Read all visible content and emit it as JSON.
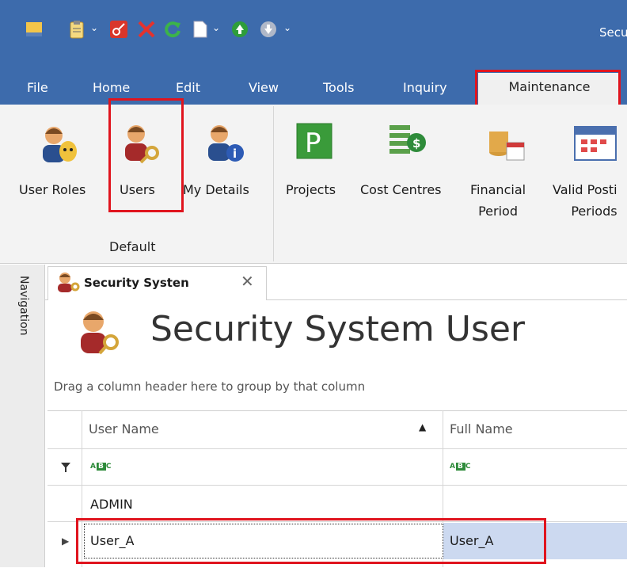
{
  "window": {
    "title": "Secu"
  },
  "quick_access": {
    "icons": [
      "app-logo-icon",
      "clipboard-icon",
      "chevron-down-icon",
      "key-icon",
      "delete-icon",
      "refresh-icon",
      "document-icon",
      "chevron-down-icon",
      "up-circle-icon",
      "down-circle-icon",
      "chevron-down-icon"
    ]
  },
  "menu": {
    "items": [
      "File",
      "Home",
      "Edit",
      "View",
      "Tools",
      "Inquiry"
    ],
    "active": "Maintenance"
  },
  "ribbon": {
    "buttons": [
      "User Roles",
      "Users",
      "My Details",
      "Projects",
      "Cost Centres",
      "Financial\nPeriod",
      "Valid Posti\nPeriods"
    ],
    "group_label": "Default"
  },
  "navigation": {
    "label": "Navigation"
  },
  "document_tab": {
    "title": "Security Systen",
    "close": "✕"
  },
  "page": {
    "title": "Security System User",
    "group_hint": "Drag a column header here to group by that column"
  },
  "grid": {
    "columns": [
      "User Name",
      "Full Name"
    ],
    "filter_icon": "filter-icon",
    "rows": [
      {
        "user_name": "ADMIN",
        "full_name": ""
      },
      {
        "user_name": "User_A",
        "full_name": "User_A",
        "selected": true
      }
    ]
  },
  "colors": {
    "titlebar": "#3d6bac",
    "highlight": "#e0141e",
    "selection": "#ccd9f0"
  }
}
